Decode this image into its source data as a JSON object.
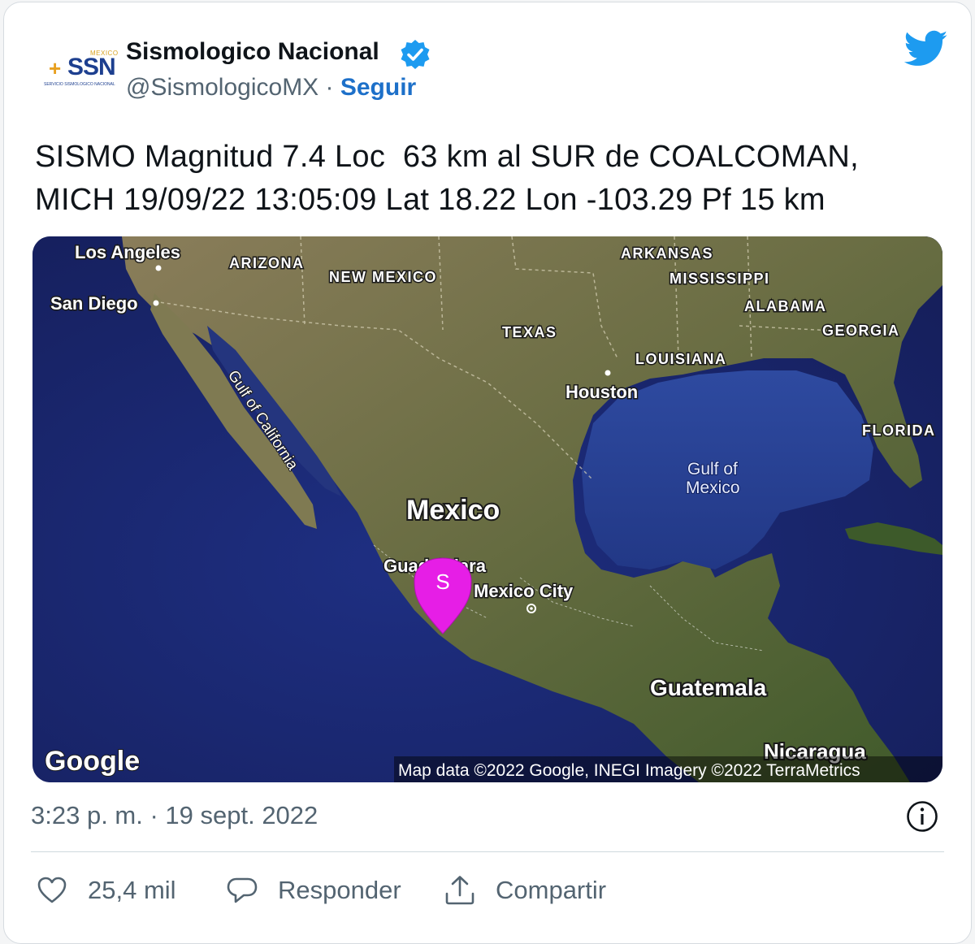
{
  "account": {
    "avatar_text": "SSN",
    "avatar_country": "MEXICO",
    "avatar_subtitle": "SERVICIO SISMOLOGICO NACIONAL",
    "display_name": "Sismologico Nacional",
    "handle": "@SismologicoMX",
    "separator": " · ",
    "follow_label": "Seguir",
    "verified": true
  },
  "tweet": {
    "line1": "SISMO Magnitud 7.4 Loc  63 km al SUR de COALCOMAN,",
    "line2": "MICH 19/09/22 13:05:09 Lat 18.22 Lon -103.29 Pf 15 km",
    "timestamp": "3:23 p. m. · 19 sept. 2022"
  },
  "map": {
    "labels": {
      "los_angeles": "Los Angeles",
      "san_diego": "San Diego",
      "arizona": "ARIZONA",
      "new_mexico": "NEW MEXICO",
      "texas": "TEXAS",
      "arkansas": "ARKANSAS",
      "mississippi": "MISSISSIPPI",
      "alabama": "ALABAMA",
      "georgia": "GEORGIA",
      "louisiana": "LOUISIANA",
      "florida": "FLORIDA",
      "houston": "Houston",
      "gulf_california": "Gulf of California",
      "gulf_mexico_1": "Gulf of",
      "gulf_mexico_2": "Mexico",
      "mexico": "Mexico",
      "guadalajara": "Guadalajara",
      "mexico_city": "Mexico City",
      "guatemala": "Guatemala",
      "nicaragua": "Nicaragua"
    },
    "marker_letter": "S",
    "marker_color": "#e61ee6",
    "google_logo": "Google",
    "attribution": "Map data ©2022 Google, INEGI Imagery ©2022 TerraMetrics"
  },
  "actions": {
    "likes": "25,4 mil",
    "reply": "Responder",
    "share": "Compartir"
  },
  "colors": {
    "link": "#1d70c9",
    "twitter_blue": "#1d9bf0",
    "ocean": "#1a2a78",
    "land": "#5a6a3a"
  }
}
